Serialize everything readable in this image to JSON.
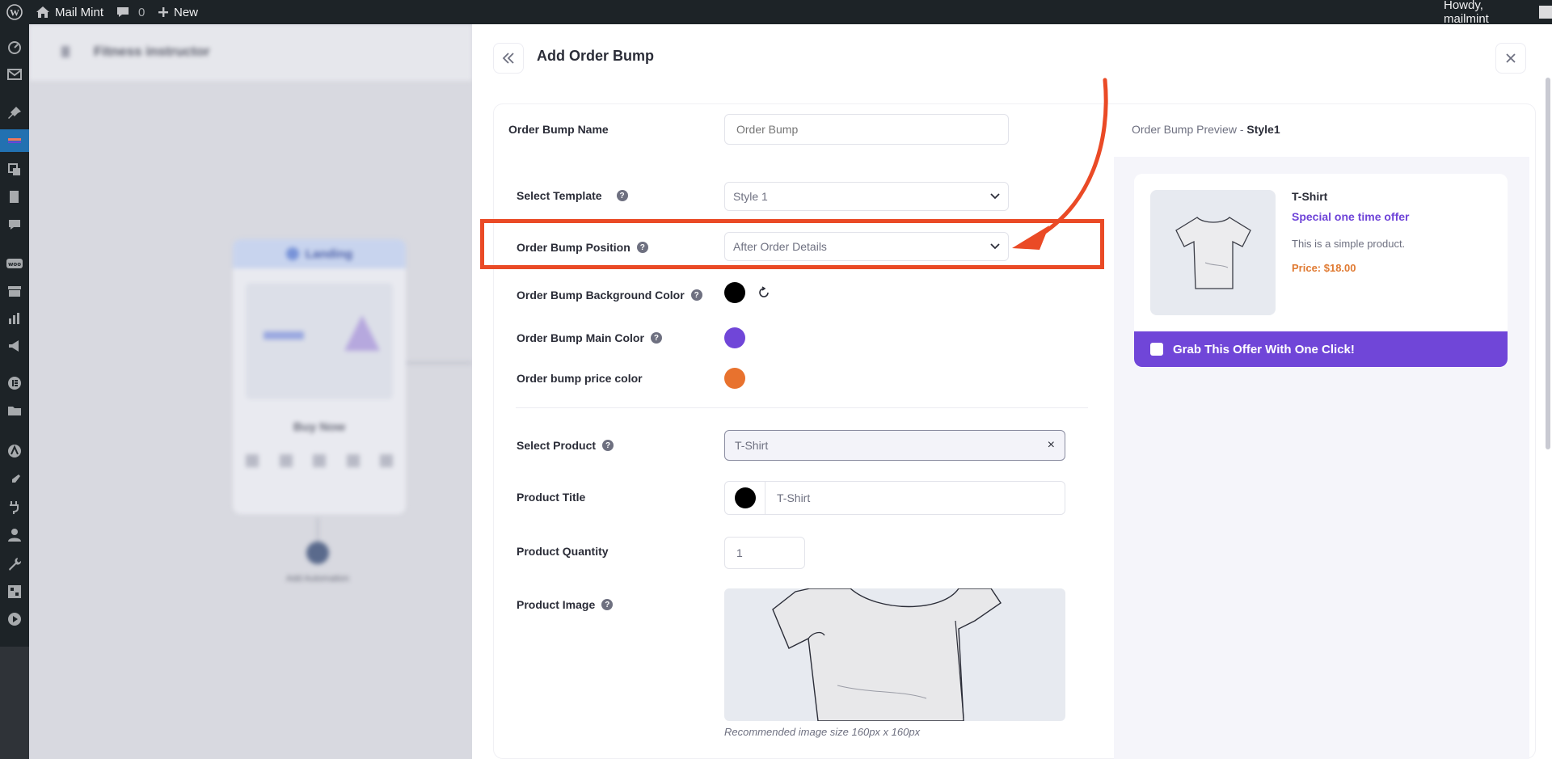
{
  "admin_bar": {
    "site_name": "Mail Mint",
    "comments_count": "0",
    "new_label": "New",
    "greeting": "Howdy, mailmint"
  },
  "drawer": {
    "title": "Add Order Bump"
  },
  "form": {
    "order_bump_name": {
      "label": "Order Bump Name",
      "placeholder": "Order Bump"
    },
    "template": {
      "label": "Select Template",
      "value": "Style 1"
    },
    "position": {
      "label": "Order Bump Position",
      "value": "After Order Details"
    },
    "background_color": {
      "label": "Order Bump Background Color",
      "color": "#000000"
    },
    "main_color": {
      "label": "Order Bump Main Color",
      "color": "#7046d8"
    },
    "price_color": {
      "label": "Order bump price color",
      "color": "#e8722e"
    },
    "product": {
      "label": "Select Product",
      "value": "T-Shirt",
      "clear": "×"
    },
    "product_title": {
      "label": "Product Title",
      "value": "T-Shirt",
      "color": "#000000"
    },
    "quantity": {
      "label": "Product Quantity",
      "value": "1"
    },
    "image": {
      "label": "Product Image",
      "hint": "Recommended image size 160px x 160px"
    }
  },
  "preview": {
    "label_prefix": "Order Bump Preview - ",
    "style": "Style1",
    "product_name": "T-Shirt",
    "offer": "Special one time offer",
    "description": "This is a simple product.",
    "price": "Price: $18.00",
    "cta": "Grab This Offer With One Click!"
  },
  "background_canvas": {
    "funnel_title": "Fitness instructor",
    "landing_label": "Landing",
    "step_label": "Buy Now",
    "node_label": "Add Automation"
  },
  "colors": {
    "annotation": "#ea4a26",
    "accent": "#7046d8",
    "price": "#e07a32"
  }
}
